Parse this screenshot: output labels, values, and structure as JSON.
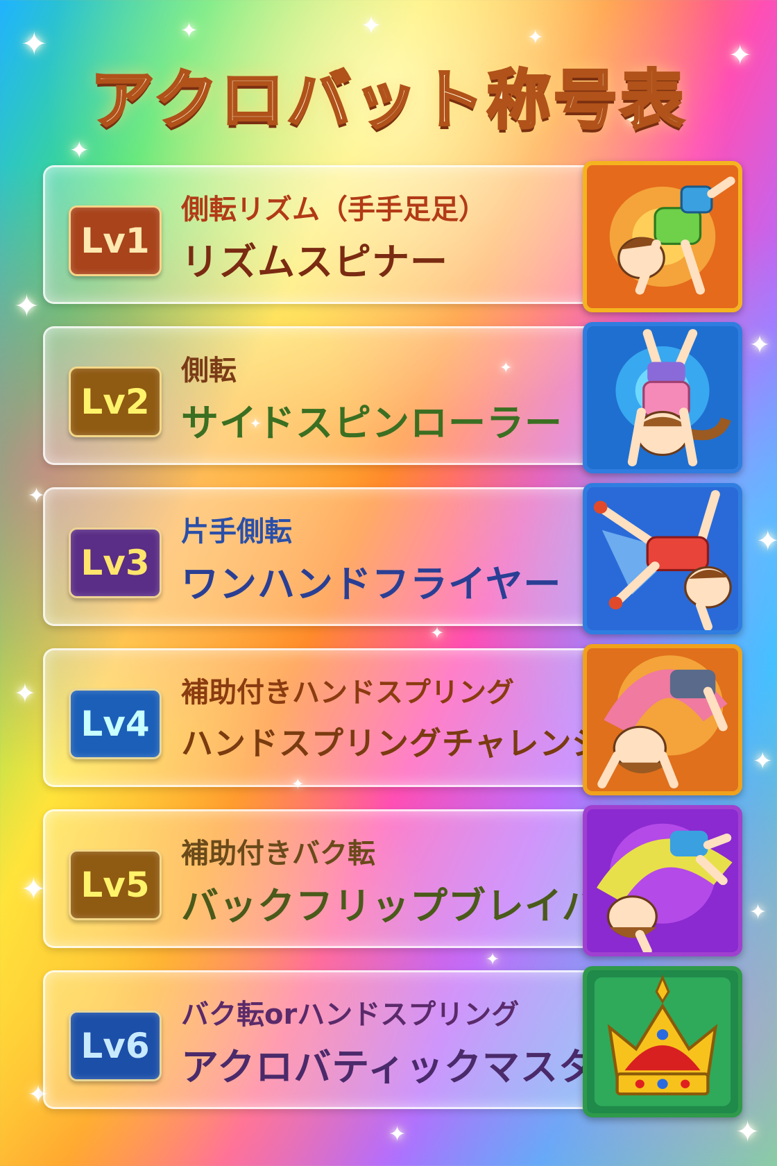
{
  "title": "アクロバット称号表",
  "levels": [
    {
      "badge": "Lv1",
      "move": "側転リズム（手手足足）",
      "rank": "リズムスピナー",
      "badge_color": "#a8431b",
      "badge_text": "#ffe9b0",
      "move_color": "#b23a16",
      "rank_color": "#7a2b12",
      "frame_color": "#f5b41f",
      "icon": "cartwheel-boy-icon"
    },
    {
      "badge": "Lv2",
      "move": "側転",
      "rank": "サイドスピンローラー",
      "badge_color": "#8f5a12",
      "badge_text": "#fff36b",
      "move_color": "#7a3b16",
      "rank_color": "#3b6f22",
      "frame_color": "#2f7de0",
      "icon": "handstand-girl-icon"
    },
    {
      "badge": "Lv3",
      "move": "片手側転",
      "rank": "ワンハンドフライヤー",
      "badge_color": "#5a2d86",
      "badge_text": "#ffe56b",
      "move_color": "#2a4fa8",
      "rank_color": "#2a3f94",
      "frame_color": "#2f7de0",
      "icon": "one-hand-cartwheel-boy-icon"
    },
    {
      "badge": "Lv4",
      "move": "補助付きハンドスプリング",
      "rank": "ハンドスプリングチャレンジャー",
      "badge_color": "#1c5fb8",
      "badge_text": "#c8ffff",
      "move_color": "#8a3b10",
      "rank_color": "#7a3b10",
      "frame_color": "#f0a21c",
      "icon": "handspring-girl-icon"
    },
    {
      "badge": "Lv5",
      "move": "補助付きバク転",
      "rank": "バックフリップブレイバー",
      "badge_color": "#8f5a12",
      "badge_text": "#fff36b",
      "move_color": "#6a4a1a",
      "rank_color": "#4a5a1a",
      "frame_color": "#a040d0",
      "icon": "backflip-boy-icon"
    },
    {
      "badge": "Lv6",
      "move": "バク転orハンドスプリング",
      "rank": "アクロバティックマスター",
      "badge_color": "#1c4fa8",
      "badge_text": "#c8eaff",
      "move_color": "#5a2a6a",
      "rank_color": "#4a2a6a",
      "frame_color": "#2e9a4a",
      "icon": "crown-icon"
    }
  ]
}
